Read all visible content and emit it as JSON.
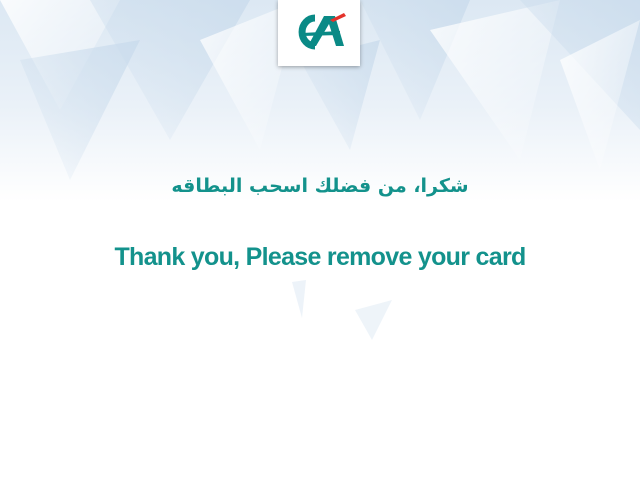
{
  "brand": {
    "logo_icon": "credit-agricole-logo-icon",
    "logo_text": "CA",
    "primary_color": "#0a8a86",
    "accent_color": "#e4322b"
  },
  "message": {
    "arabic": "شكرا، من فضلك اسحب البطاقه",
    "english": "Thank you, Please remove your card",
    "text_color": "#13928c"
  }
}
